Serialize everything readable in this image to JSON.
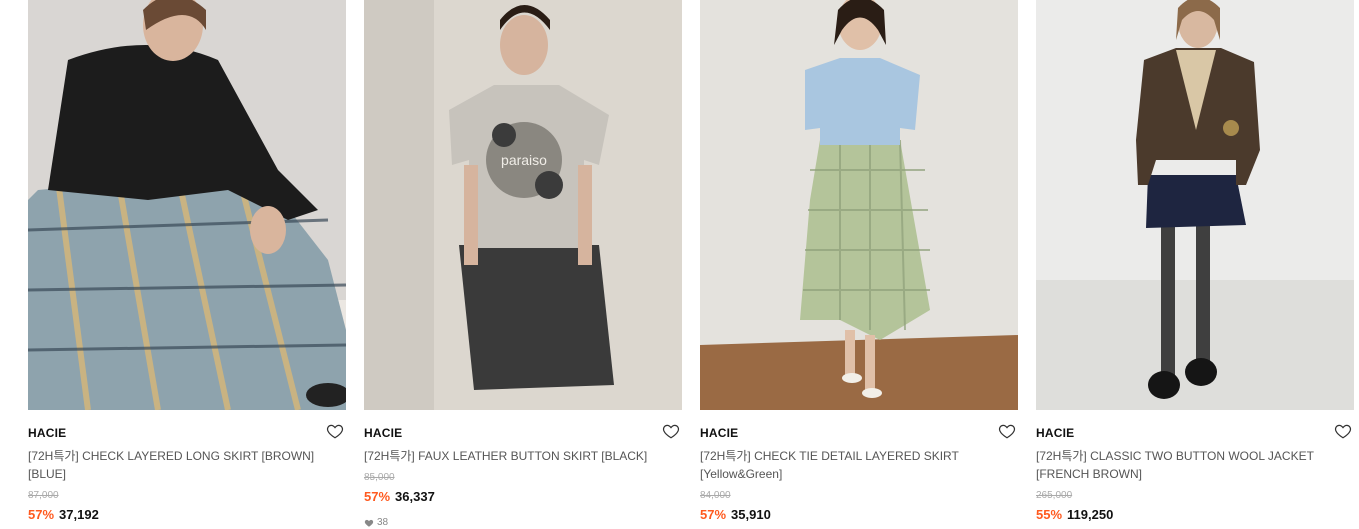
{
  "products": [
    {
      "brand": "HACIE",
      "name": "[72H특가] CHECK LAYERED LONG SKIRT [BROWN] [BLUE]",
      "original_price": "87,000",
      "discount": "57%",
      "price": "37,192",
      "image_icon": "product-photo",
      "wish_icon": "heart-outline-icon"
    },
    {
      "brand": "HACIE",
      "name": "[72H특가] FAUX LEATHER BUTTON SKIRT [BLACK]",
      "original_price": "85,000",
      "discount": "57%",
      "price": "36,337",
      "likes": "38",
      "image_icon": "product-photo",
      "wish_icon": "heart-outline-icon"
    },
    {
      "brand": "HACIE",
      "name": "[72H특가] CHECK TIE DETAIL LAYERED SKIRT [Yellow&Green]",
      "original_price": "84,000",
      "discount": "57%",
      "price": "35,910",
      "image_icon": "product-photo",
      "wish_icon": "heart-outline-icon"
    },
    {
      "brand": "HACIE",
      "name": "[72H특가] CLASSIC TWO BUTTON WOOL JACKET [FRENCH BROWN]",
      "original_price": "265,000",
      "discount": "55%",
      "price": "119,250",
      "image_icon": "product-photo",
      "wish_icon": "heart-outline-icon"
    }
  ],
  "colors": {
    "discount": "#ff5a1f",
    "brand_text": "#111111",
    "name_text": "#555555",
    "strike_text": "#aaaaaa"
  },
  "photo_texts": {
    "tshirt_print": "paraiso"
  }
}
